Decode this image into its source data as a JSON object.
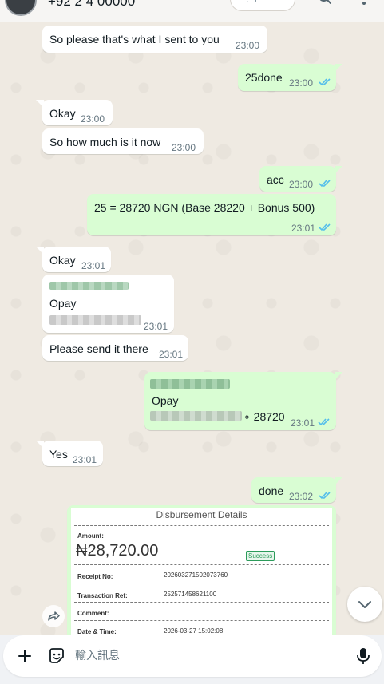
{
  "header": {
    "title": "+92 2 4 00000",
    "search_icon": "search-icon",
    "menu_icon": "more-vertical-icon"
  },
  "messages": [
    {
      "id": "m1",
      "dir": "in",
      "text": "So please that's what I sent to you",
      "time": "23:00"
    },
    {
      "id": "m2",
      "dir": "out",
      "text": "25done",
      "time": "23:00",
      "status": "read"
    },
    {
      "id": "m3",
      "dir": "in",
      "text": "Okay",
      "time": "23:00"
    },
    {
      "id": "m4",
      "dir": "in",
      "text": "So how much is it now",
      "time": "23:00"
    },
    {
      "id": "m5",
      "dir": "out",
      "text": "acc",
      "time": "23:00",
      "status": "read"
    },
    {
      "id": "m6",
      "dir": "out",
      "text": "25 = 28720 NGN (Base 28220 + Bonus 500)",
      "time": "23:01",
      "status": "read"
    },
    {
      "id": "m7",
      "dir": "in",
      "text": "Okay",
      "time": "23:01"
    },
    {
      "id": "m8",
      "dir": "in",
      "line1": "Opay",
      "time": "23:01",
      "redacted": true
    },
    {
      "id": "m9",
      "dir": "in",
      "text": "Please send it there",
      "time": "23:01"
    },
    {
      "id": "m10",
      "dir": "out",
      "line1": "Opay",
      "suffix": "∘ 28720",
      "time": "23:01",
      "status": "read",
      "redacted": true
    },
    {
      "id": "m11",
      "dir": "in",
      "text": "Yes",
      "time": "23:01"
    },
    {
      "id": "m12",
      "dir": "out",
      "text": "done",
      "time": "23:02",
      "status": "read"
    }
  ],
  "receipt": {
    "title": "Disbursement Details",
    "amount_label": "Amount:",
    "amount": "₦28,720.00",
    "status": "Success",
    "receipt_no_label": "Receipt No:",
    "receipt_no": "202603271502073760",
    "transaction_ref_label": "Transaction Ref:",
    "transaction_ref": "252571458621100",
    "comment_label": "Comment:",
    "date_label": "Date & Time:",
    "date": "2026-03-27 15:02:08"
  },
  "composer": {
    "placeholder": "輸入訊息",
    "value": ""
  },
  "colors": {
    "outgoing_bubble": "#d9fdd3",
    "incoming_bubble": "#ffffff",
    "read_ticks": "#53bdeb",
    "wallpaper": "#efeae2",
    "redaction_green": "#9fc7a9"
  }
}
